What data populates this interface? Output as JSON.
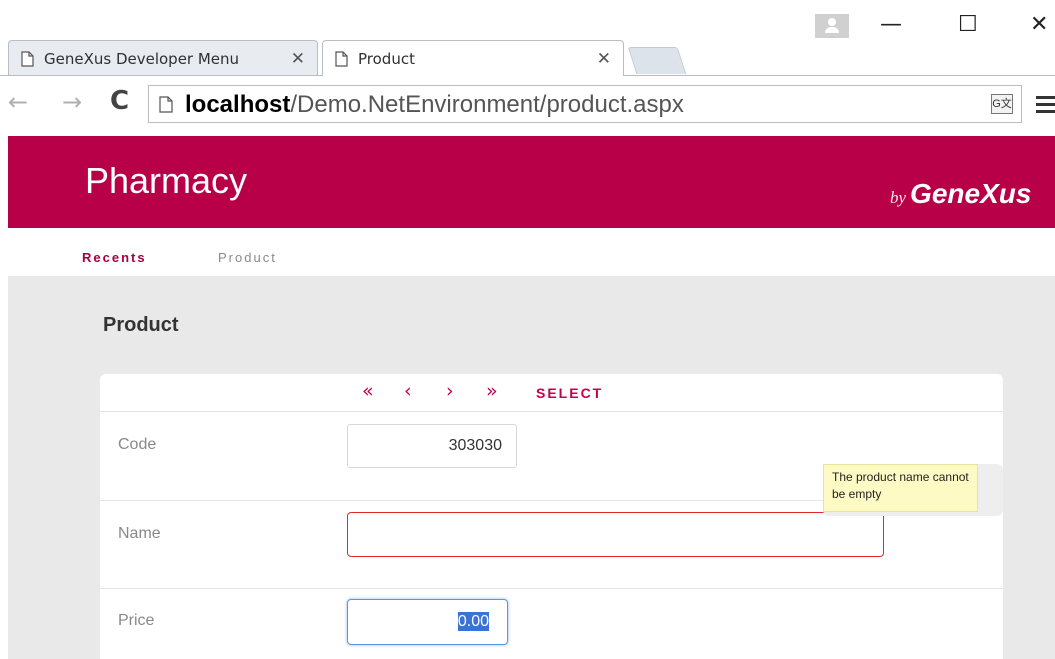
{
  "browser": {
    "tabs": [
      {
        "label": "GeneXus Developer Menu",
        "active": false
      },
      {
        "label": "Product",
        "active": true
      }
    ],
    "address": {
      "host": "localhost",
      "path": "/Demo.NetEnvironment/product.aspx"
    },
    "window_controls": {
      "minimize": "—",
      "maximize": "☐",
      "close": "✕"
    },
    "tab_close": "✕",
    "nav": {
      "back": "←",
      "forward": "→",
      "reload": "C"
    }
  },
  "app": {
    "title": "Pharmacy",
    "brand_by": "by",
    "brand_name": "GeneXus",
    "accent_color": "#b80048"
  },
  "subnav": {
    "items": [
      {
        "label": "Recents",
        "active": true
      },
      {
        "label": "Product",
        "active": false
      }
    ]
  },
  "page": {
    "title": "Product",
    "pager": {
      "first": "«",
      "previous": "‹",
      "next": "›",
      "last": "»",
      "select": "SELECT"
    },
    "fields": {
      "code": {
        "label": "Code",
        "value": "303030"
      },
      "name": {
        "label": "Name",
        "value": "",
        "error": "The product name cannot be empty"
      },
      "price": {
        "label": "Price",
        "value": "0.00"
      }
    }
  }
}
